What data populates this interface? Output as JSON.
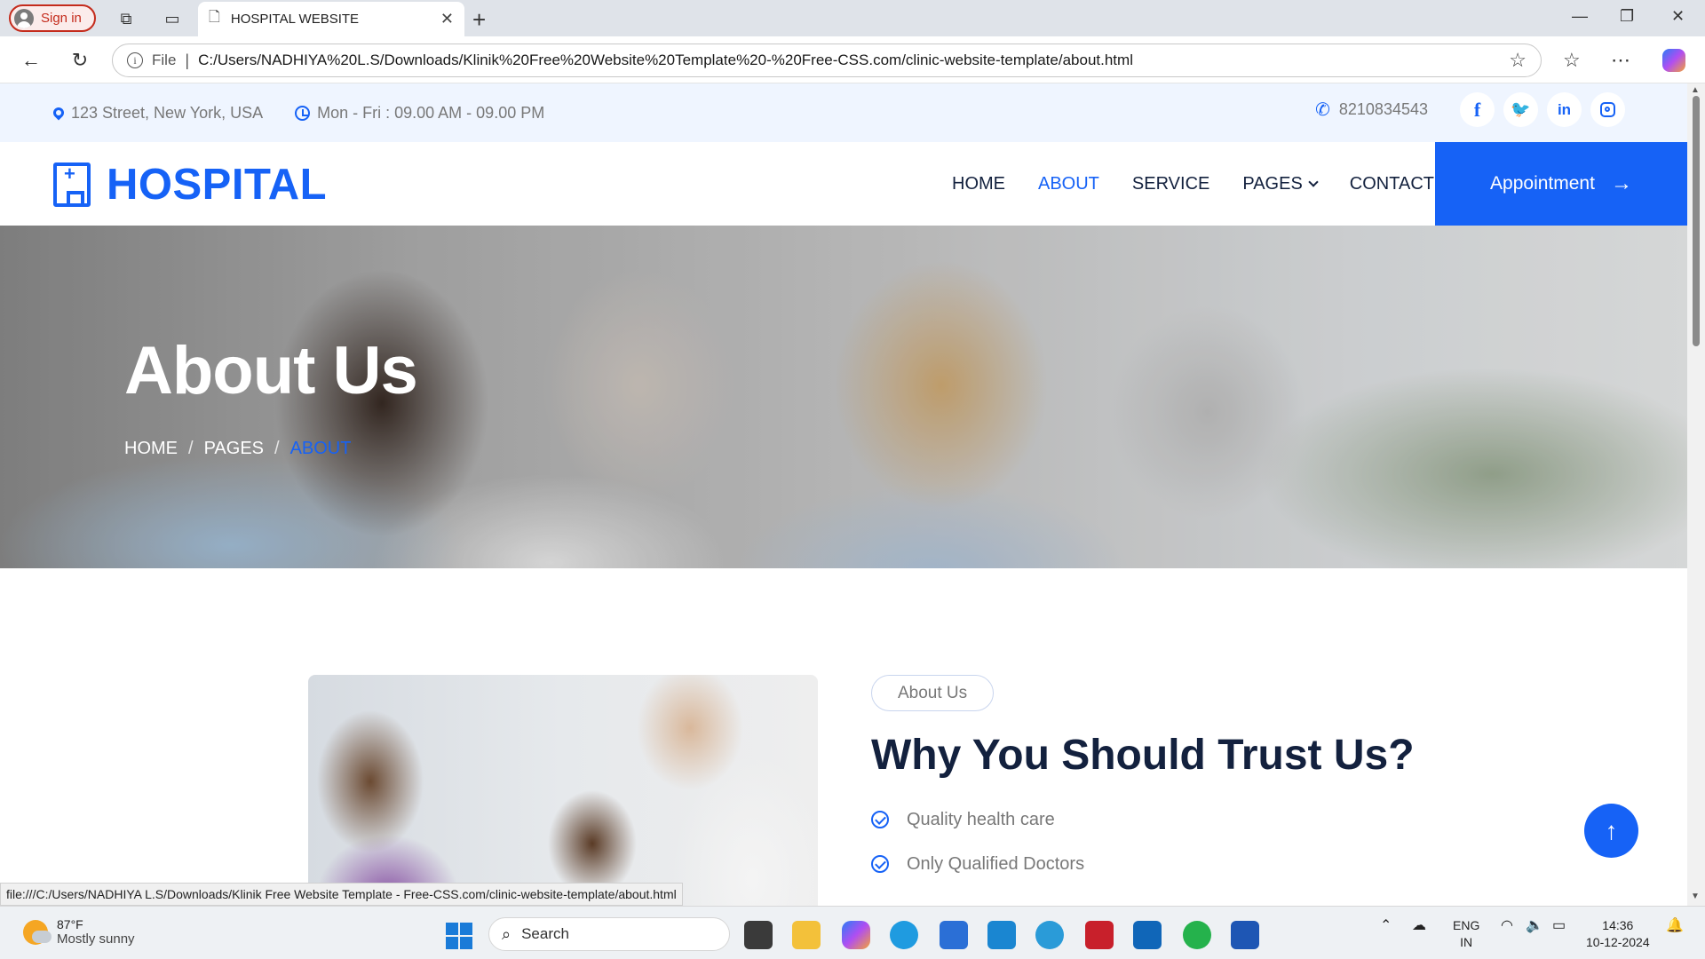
{
  "browser": {
    "signin_label": "Sign in",
    "tab_title": "HOSPITAL WEBSITE",
    "omnibox_scheme": "File",
    "url": "C:/Users/NADHIYA%20L.S/Downloads/Klinik%20Free%20Website%20Template%20-%20Free-CSS.com/clinic-website-template/about.html",
    "status_url": "file:///C:/Users/NADHIYA L.S/Downloads/Klinik Free Website Template - Free-CSS.com/clinic-website-template/about.html"
  },
  "site": {
    "topbar": {
      "address": "123 Street, New York, USA",
      "hours": "Mon - Fri : 09.00 AM - 09.00 PM",
      "phone": "8210834543",
      "socials": [
        "f",
        "t",
        "in",
        "ig"
      ]
    },
    "brand": "HOSPITAL",
    "menu": [
      {
        "label": "HOME",
        "active": false
      },
      {
        "label": "ABOUT",
        "active": true
      },
      {
        "label": "SERVICE",
        "active": false
      },
      {
        "label": "PAGES",
        "active": false
      },
      {
        "label": "CONTACT",
        "active": false
      }
    ],
    "appointment_label": "Appointment",
    "hero": {
      "title": "About Us",
      "breadcrumb": [
        "HOME",
        "PAGES",
        "ABOUT"
      ]
    },
    "about": {
      "badge": "About Us",
      "heading": "Why You Should Trust Us?",
      "points": [
        "Quality health care",
        "Only Qualified Doctors"
      ]
    }
  },
  "taskbar": {
    "weather_temp": "87°F",
    "weather_desc": "Mostly sunny",
    "search_label": "Search",
    "lang_top": "ENG",
    "lang_bottom": "IN",
    "time": "14:36",
    "date": "10-12-2024"
  },
  "colors": {
    "accent": "#1662f6",
    "heading": "#13213e",
    "topbar_bg": "#eff5ff"
  }
}
